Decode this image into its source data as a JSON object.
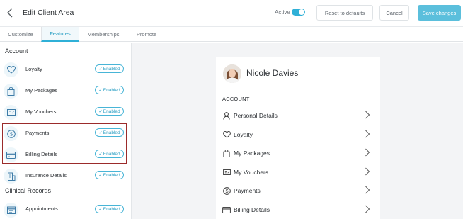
{
  "header": {
    "title": "Edit Client Area",
    "active_label": "Active",
    "active_on": true,
    "reset_label": "Reset to defaults",
    "cancel_label": "Cancel",
    "save_label": "Save changes",
    "accent_color": "#2fb0d7"
  },
  "tabs": [
    {
      "label": "Customize",
      "active": false
    },
    {
      "label": "Features",
      "active": true
    },
    {
      "label": "Memberships",
      "active": false
    },
    {
      "label": "Promote",
      "active": false
    }
  ],
  "sidebar": {
    "sections": [
      {
        "title": "Account",
        "items": [
          {
            "label": "Loyalty",
            "icon": "heart-icon",
            "status": "Enabled"
          },
          {
            "label": "My Packages",
            "icon": "bag-icon",
            "status": "Enabled"
          },
          {
            "label": "My Vouchers",
            "icon": "voucher-icon",
            "status": "Enabled"
          },
          {
            "label": "Payments",
            "icon": "dollar-icon",
            "status": "Enabled"
          },
          {
            "label": "Billing Details",
            "icon": "card-icon",
            "status": "Enabled"
          },
          {
            "label": "Insurance Details",
            "icon": "building-icon",
            "status": "Enabled"
          }
        ]
      },
      {
        "title": "Clinical Records",
        "items": [
          {
            "label": "Appointments",
            "icon": "calendar-icon",
            "status": "Enabled"
          }
        ]
      }
    ]
  },
  "preview": {
    "profile_name": "Nicole Davies",
    "section_title": "ACCOUNT",
    "rows": [
      {
        "label": "Personal Details",
        "icon": "person-icon"
      },
      {
        "label": "Loyalty",
        "icon": "heart-icon"
      },
      {
        "label": "My Packages",
        "icon": "bag-icon"
      },
      {
        "label": "My Vouchers",
        "icon": "voucher-icon"
      },
      {
        "label": "Payments",
        "icon": "dollar-icon"
      },
      {
        "label": "Billing Details",
        "icon": "card-icon"
      }
    ]
  }
}
